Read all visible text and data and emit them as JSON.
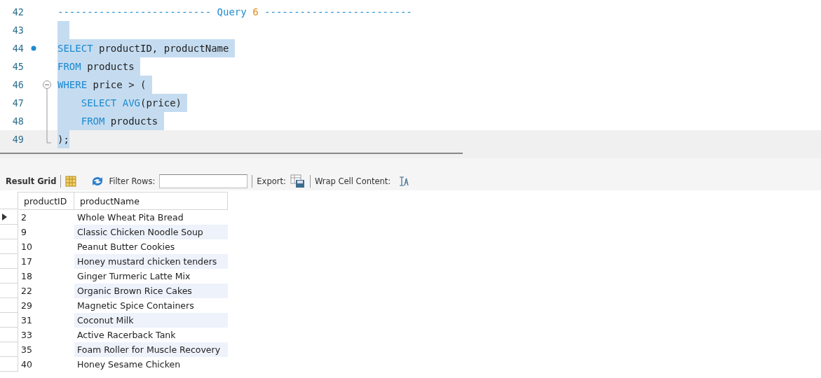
{
  "editor": {
    "lines": [
      {
        "number": "42",
        "kind": "plain",
        "selected": false,
        "tokens": [
          {
            "kind": "keyword",
            "text": "-------------------------- Query "
          },
          {
            "kind": "number",
            "text": "6"
          },
          {
            "kind": "keyword",
            "text": " -------------------------"
          }
        ]
      },
      {
        "number": "43",
        "kind": "plain",
        "selected": true
      },
      {
        "number": "44",
        "kind": "breakpoint",
        "selected": true,
        "tokens": [
          {
            "kind": "keyword",
            "text": "SELECT"
          },
          {
            "kind": "plain",
            "text": " productID, productName "
          }
        ]
      },
      {
        "number": "45",
        "kind": "plain",
        "selected": true,
        "tokens": [
          {
            "kind": "keyword",
            "text": "FROM"
          },
          {
            "kind": "plain",
            "text": " products "
          }
        ]
      },
      {
        "number": "46",
        "kind": "foldstart",
        "selected": true,
        "tokens": [
          {
            "kind": "keyword",
            "text": "WHERE"
          },
          {
            "kind": "plain",
            "text": " price > ( "
          }
        ]
      },
      {
        "number": "47",
        "kind": "folded",
        "selected": true,
        "tokens": [
          {
            "kind": "keyword",
            "text": "    SELECT AVG"
          },
          {
            "kind": "plain",
            "text": "(price) "
          }
        ]
      },
      {
        "number": "48",
        "kind": "folded",
        "selected": true,
        "tokens": [
          {
            "kind": "keyword",
            "text": "    FROM"
          },
          {
            "kind": "plain",
            "text": " products "
          }
        ]
      },
      {
        "number": "49",
        "kind": "foldend",
        "selected": true,
        "tokens": [
          {
            "kind": "plain",
            "text": ");"
          }
        ]
      }
    ]
  },
  "toolbar": {
    "result_grid": "Result Grid",
    "filter_label": "Filter Rows:",
    "export_label": "Export:",
    "wrap_label": "Wrap Cell Content:"
  },
  "grid": {
    "columns": [
      "productID",
      "productName"
    ],
    "rows": [
      {
        "selected": true,
        "cells": [
          "2",
          "Whole Wheat Pita Bread"
        ]
      },
      {
        "selected": false,
        "cells": [
          "9",
          "Classic Chicken Noodle Soup"
        ]
      },
      {
        "selected": false,
        "cells": [
          "10",
          "Peanut Butter Cookies"
        ]
      },
      {
        "selected": false,
        "cells": [
          "17",
          "Honey mustard chicken tenders"
        ]
      },
      {
        "selected": false,
        "cells": [
          "18",
          "Ginger Turmeric Latte Mix"
        ]
      },
      {
        "selected": false,
        "cells": [
          "22",
          "Organic Brown Rice Cakes"
        ]
      },
      {
        "selected": false,
        "cells": [
          "29",
          "Magnetic Spice Containers"
        ]
      },
      {
        "selected": false,
        "cells": [
          "31",
          "Coconut Milk"
        ]
      },
      {
        "selected": false,
        "cells": [
          "33",
          "Active Racerback Tank"
        ]
      },
      {
        "selected": false,
        "cells": [
          "35",
          "Foam Roller for Muscle Recovery"
        ]
      },
      {
        "selected": false,
        "cells": [
          "40",
          "Honey Sesame Chicken"
        ]
      }
    ]
  }
}
